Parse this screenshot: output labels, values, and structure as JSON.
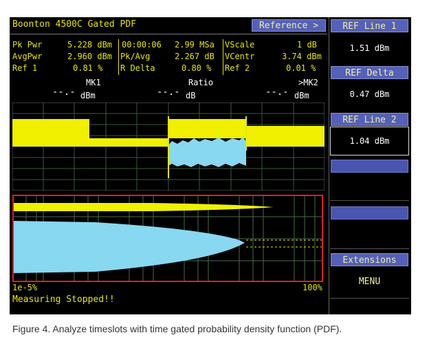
{
  "header": {
    "title": "Boonton 4500C Gated PDF",
    "reference_button": "Reference >"
  },
  "measurements": {
    "pk_pwr_label": "Pk Pwr",
    "pk_pwr_value": "5.228 dBm",
    "avg_pwr_label": "AvgPwr",
    "avg_pwr_value": "2.960 dBm",
    "ref1_label": "Ref 1",
    "ref1_value": "0.81 %",
    "time_value": "00:00:06",
    "rate_value": "2.99 MSa",
    "pk_avg_label": "Pk/Avg",
    "pk_avg_value": "2.267 dB",
    "r_delta_label": "R Delta",
    "r_delta_value": "0.80 %",
    "vscale_label": "VScale",
    "vscale_value": "1 dB",
    "vcentr_label": "VCentr",
    "vcentr_value": "3.74 dBm",
    "ref2_label": "Ref 2",
    "ref2_value": "0.01 %"
  },
  "markers": {
    "mk1_label": "MK1",
    "mk1_value": "--.-",
    "mk1_unit": "dBm",
    "ratio_label": "Ratio",
    "ratio_value": "--.-",
    "ratio_unit": "dB",
    "mk2_label": ">MK2",
    "mk2_value": "--.-",
    "mk2_unit": "dBm"
  },
  "pdf_axis": {
    "left_label": "1e-5%",
    "right_label": "100%"
  },
  "status": "Measuring Stopped!!",
  "softkeys": {
    "ref_line1_label": "REF Line 1",
    "ref_line1_value": "1.51 dBm",
    "ref_delta_label": "REF Delta",
    "ref_delta_value": "0.47 dBm",
    "ref_line2_label": "REF Line 2",
    "ref_line2_value": "1.04 dBm",
    "extensions_label": "Extensions",
    "menu_label": "MENU"
  },
  "caption": "Figure 4. Analyze timeslots with time gated probability density function (PDF).",
  "colors": {
    "trace_yellow": "#f0f000",
    "trace_cyan": "#87d8f0",
    "pdf_border": "#e02020",
    "softkey_blue": "#5560b8"
  }
}
